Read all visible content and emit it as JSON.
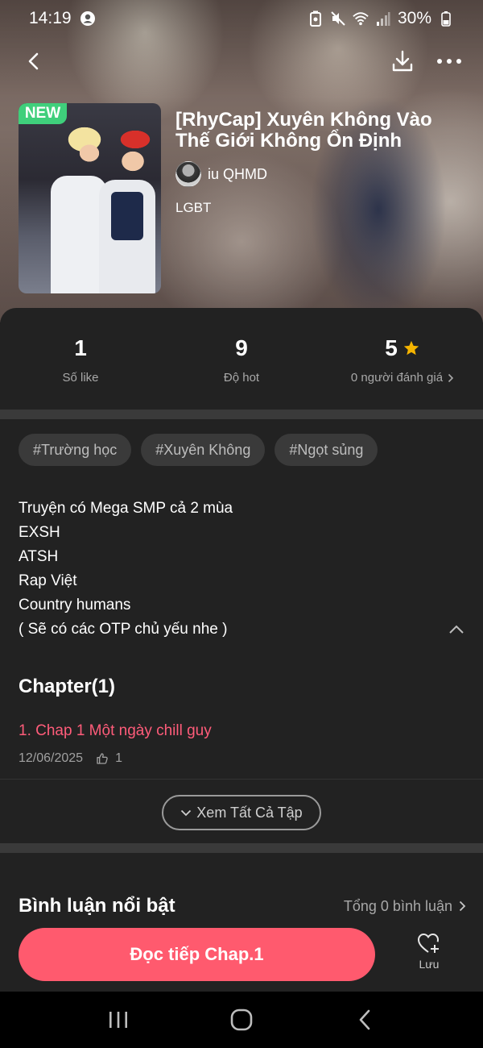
{
  "status_bar": {
    "time": "14:19",
    "battery": "30%"
  },
  "nav": {
    "back_icon": "back-arrow-icon",
    "download_icon": "download-icon",
    "more_icon": "more-icon"
  },
  "story": {
    "badge": "NEW",
    "title": "[RhyCap] Xuyên Không Vào Thế Giới Không Ổn Định",
    "author": "iu QHMD",
    "genre": "LGBT"
  },
  "stats": [
    {
      "value": "1",
      "label": "Số like"
    },
    {
      "value": "9",
      "label": "Độ hot"
    },
    {
      "value": "5",
      "label": "0 người đánh giá"
    }
  ],
  "tags": [
    "#Trường học",
    "#Xuyên Không",
    "#Ngọt sủng"
  ],
  "description": [
    "Truyện có Mega SMP cả 2 mùa",
    "EXSH",
    "ATSH",
    "Rap Việt",
    "Country humans",
    "( Sẽ có các OTP chủ yếu nhe )"
  ],
  "chapters": {
    "heading": "Chapter(1)",
    "items": [
      {
        "title": "1. Chap 1 Một ngày chill guy",
        "date": "12/06/2025",
        "likes": "1"
      }
    ],
    "see_all": "Xem Tất Cả Tập"
  },
  "comments": {
    "title": "Bình luận nổi bật",
    "total": "Tổng 0 bình luận"
  },
  "actions": {
    "read_label": "Đọc tiếp Chap.1",
    "save_label": "Lưu"
  },
  "colors": {
    "accent": "#ff5a6e",
    "chapter_link": "#ff5c7a",
    "new_badge": "#3fcf7b",
    "star": "#f5b400",
    "panel": "#222222"
  }
}
